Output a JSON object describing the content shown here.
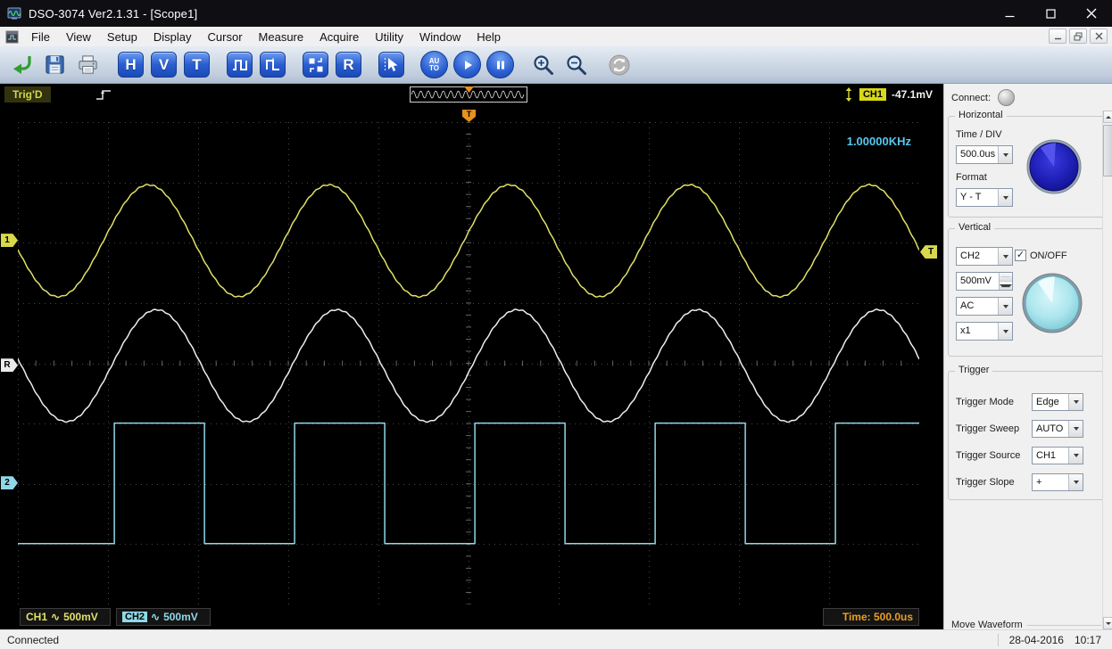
{
  "window": {
    "title": "DSO-3074 Ver2.1.31 - [Scope1]"
  },
  "menubar": {
    "items": [
      "File",
      "View",
      "Setup",
      "Display",
      "Cursor",
      "Measure",
      "Acquire",
      "Utility",
      "Window",
      "Help"
    ]
  },
  "toolbar": {
    "letter_buttons": {
      "h": "H",
      "v": "V",
      "t": "T",
      "r": "R"
    },
    "autoset_label": {
      "top": "AU",
      "bottom": "TO"
    },
    "button_names": [
      "open",
      "save",
      "print",
      "horizontal",
      "vertical",
      "trigger",
      "waveform-a",
      "waveform-b",
      "self-cal",
      "reference",
      "cursor",
      "autoset",
      "run",
      "pause",
      "zoom-in",
      "zoom-out",
      "refresh"
    ]
  },
  "trigger_strip": {
    "status": "Trig'D",
    "channel_badge": "CH1",
    "level_readout": "-47.1mV"
  },
  "scope": {
    "frequency_readout": "1.00000KHz",
    "trigger_level_frac": 0.27,
    "markers": {
      "ch1": "1",
      "ref": "R",
      "ch2": "2",
      "trigger_top": "T",
      "trigger_level": "T"
    },
    "readouts": {
      "ch1_label": "CH1",
      "ch1_coupling": "∿",
      "ch1_scale": "500mV",
      "ch2_label": "CH2",
      "ch2_coupling": "∿",
      "ch2_scale": "500mV",
      "time_label": "Time: 500.0us"
    }
  },
  "right_panel": {
    "connect_label": "Connect:",
    "horizontal": {
      "title": "Horizontal",
      "time_div_label": "Time / DIV",
      "time_div_value": "500.0us",
      "format_label": "Format",
      "format_value": "Y - T"
    },
    "vertical": {
      "title": "Vertical",
      "channel_value": "CH2",
      "onoff_label": "ON/OFF",
      "volts_value": "500mV",
      "coupling_value": "AC",
      "probe_value": "x1"
    },
    "trigger": {
      "title": "Trigger",
      "rows": [
        {
          "label": "Trigger Mode",
          "value": "Edge"
        },
        {
          "label": "Trigger Sweep",
          "value": "AUTO"
        },
        {
          "label": "Trigger Source",
          "value": "CH1"
        },
        {
          "label": "Trigger Slope",
          "value": "+"
        }
      ]
    },
    "move_waveform_label": "Move Waveform"
  },
  "statusbar": {
    "left": "Connected",
    "date": "28-04-2016",
    "time": "10:17"
  },
  "colors": {
    "ch1": "#e0e068",
    "ch2": "#90d8e8",
    "ref": "#eeeeee",
    "grid": "#464646",
    "trigger_marker": "#e8921e",
    "freq_readout": "#58c8f0",
    "time_readout": "#e8a020",
    "trig_status": "#ccd848"
  },
  "chart_data": {
    "type": "line",
    "title": "DSO-3074 oscilloscope traces",
    "x_divisions": 10,
    "y_divisions": 8,
    "time_per_div": "500.0us",
    "frequency": "1.00000KHz",
    "trigger_x_frac": 0.5,
    "series": [
      {
        "name": "CH1",
        "waveform": "sine",
        "color_key": "ch1",
        "volts_per_div": "500mV",
        "center_frac": 0.246,
        "amplitude_frac": 0.116,
        "period_frac": 0.2,
        "peak_x_frac": 0.145
      },
      {
        "name": "REF",
        "waveform": "sine",
        "color_key": "ref",
        "center_frac": 0.505,
        "amplitude_frac": 0.116,
        "period_frac": 0.2,
        "peak_x_frac": 0.154
      },
      {
        "name": "CH2",
        "waveform": "square",
        "color_key": "ch2",
        "volts_per_div": "500mV",
        "center_frac": 0.749,
        "amplitude_frac": 0.125,
        "period_frac": 0.2,
        "rise_x_frac": 0.107,
        "duty_cycle": 0.5
      }
    ]
  }
}
